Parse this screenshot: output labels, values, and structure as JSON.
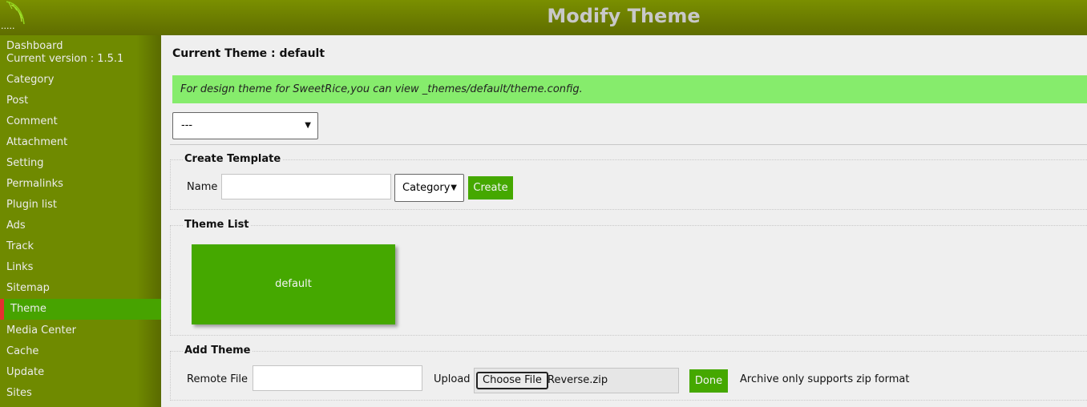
{
  "header": {
    "title": "Modify Theme",
    "logo_icon": "leaf-logo-icon",
    "logo_dots": "....."
  },
  "sidebar": {
    "dashboard": "Dashboard",
    "version": "Current version : 1.5.1",
    "items": [
      {
        "label": "Category"
      },
      {
        "label": "Post"
      },
      {
        "label": "Comment"
      },
      {
        "label": "Attachment"
      },
      {
        "label": "Setting"
      },
      {
        "label": "Permalinks"
      },
      {
        "label": "Plugin list"
      },
      {
        "label": "Ads"
      },
      {
        "label": "Track"
      },
      {
        "label": "Links"
      },
      {
        "label": "Sitemap"
      },
      {
        "label": "Theme",
        "active": true
      },
      {
        "label": "Media Center"
      },
      {
        "label": "Cache"
      },
      {
        "label": "Update"
      },
      {
        "label": "Sites"
      }
    ]
  },
  "main": {
    "current_theme": "Current Theme : default",
    "notice": "For design theme for SweetRice,you can view _themes/default/theme.config.",
    "theme_select_value": "---",
    "create_template": {
      "legend": "Create Template",
      "name_label": "Name",
      "name_value": "",
      "type_value": "Category",
      "create_label": "Create"
    },
    "theme_list": {
      "legend": "Theme List",
      "themes": [
        "default"
      ]
    },
    "add_theme": {
      "legend": "Add Theme",
      "remote_label": "Remote File",
      "remote_value": "",
      "upload_label": "Upload",
      "choose_label": "Choose File",
      "file_name": "Reverse.zip",
      "done_label": "Done",
      "hint": "Archive only supports zip format"
    }
  },
  "colors": {
    "header": "#6f8400",
    "sidebar": "#6f8a00",
    "active": "#47a300",
    "active_marker": "#e53030",
    "button": "#45a800",
    "notice": "#86ec6c"
  }
}
